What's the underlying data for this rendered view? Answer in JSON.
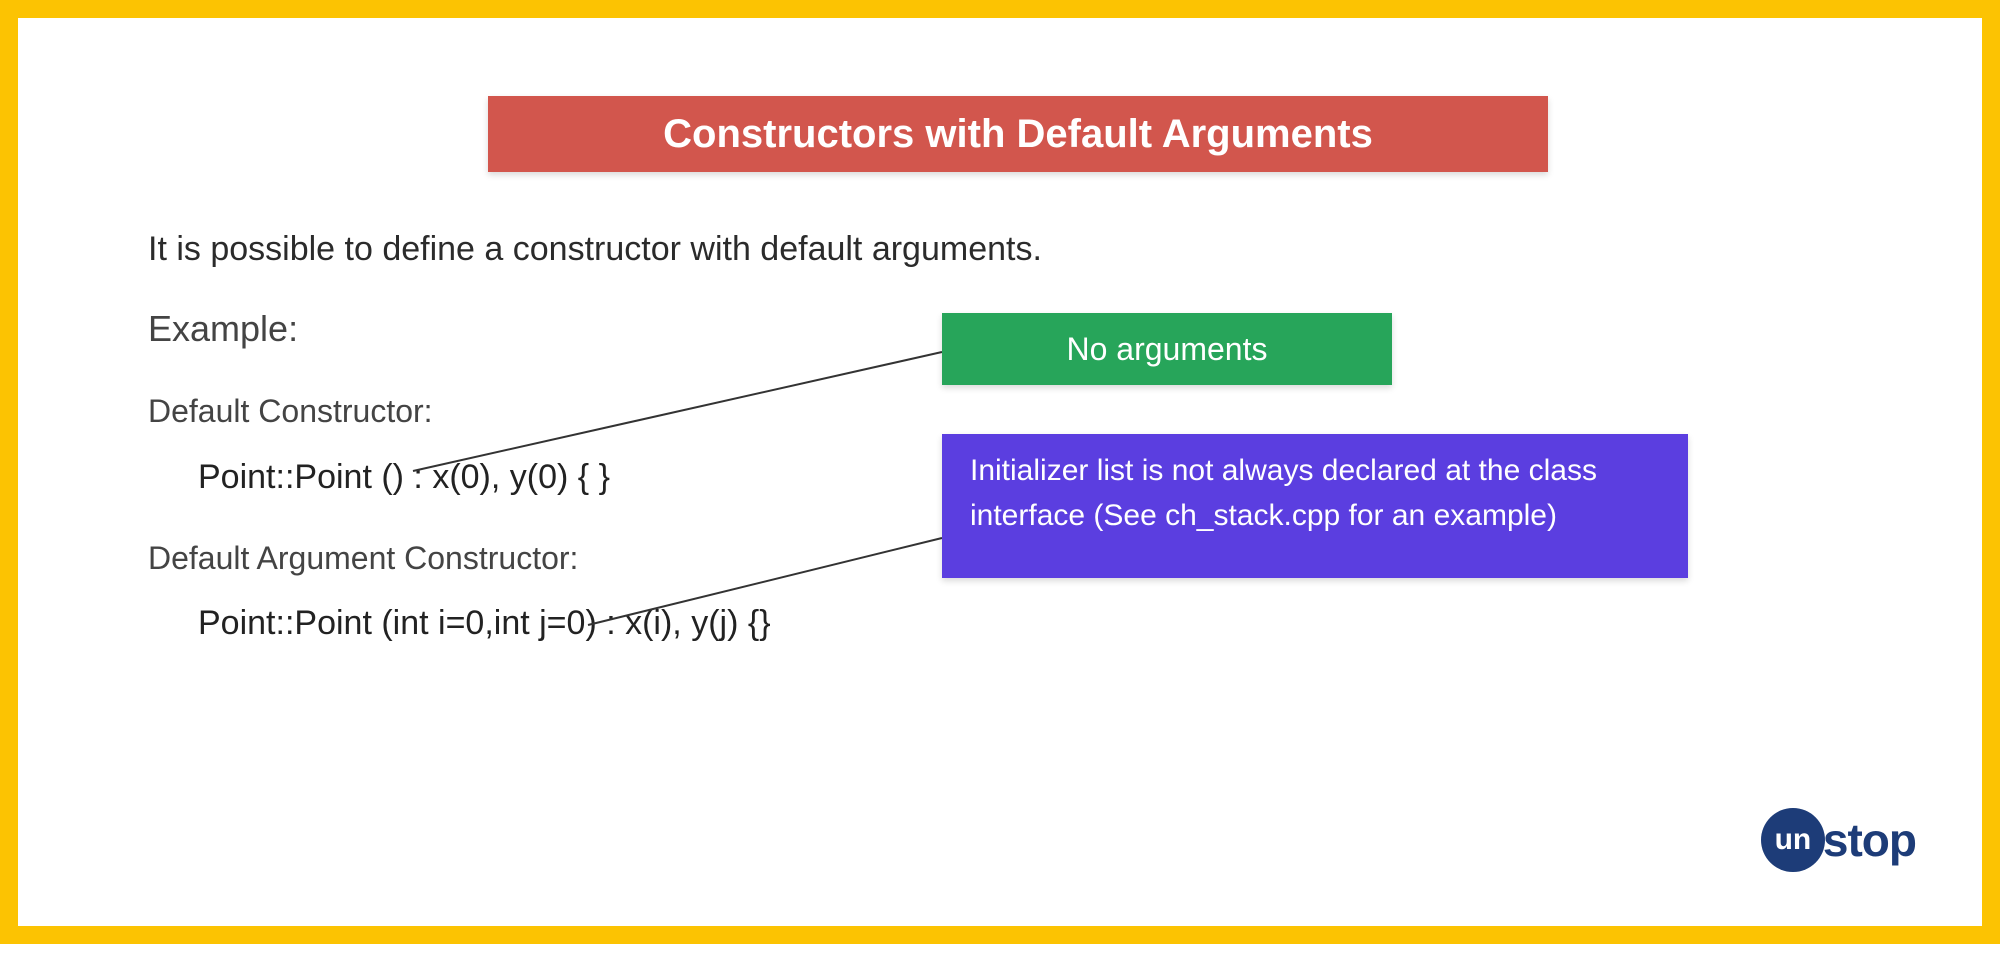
{
  "title": "Constructors with Default Arguments",
  "intro": "It is possible to define a constructor with default arguments.",
  "exampleLabel": "Example:",
  "section1": {
    "label": "Default Constructor:",
    "code": "Point::Point () : x(0), y(0) { }"
  },
  "section2": {
    "label": "Default Argument Constructor:",
    "code": "Point::Point (int i=0,int j=0) : x(i), y(j) {}"
  },
  "callouts": {
    "noArgs": "No arguments",
    "initList": "Initializer list is not always declared at the class interface (See ch_stack.cpp for an example)"
  },
  "logo": {
    "circle": "un",
    "rest": "stop"
  },
  "colors": {
    "border": "#fcc302",
    "titleBg": "#d2564d",
    "greenBg": "#27a55a",
    "purpleBg": "#5b3ee0",
    "logoBlue": "#1d3c78"
  }
}
